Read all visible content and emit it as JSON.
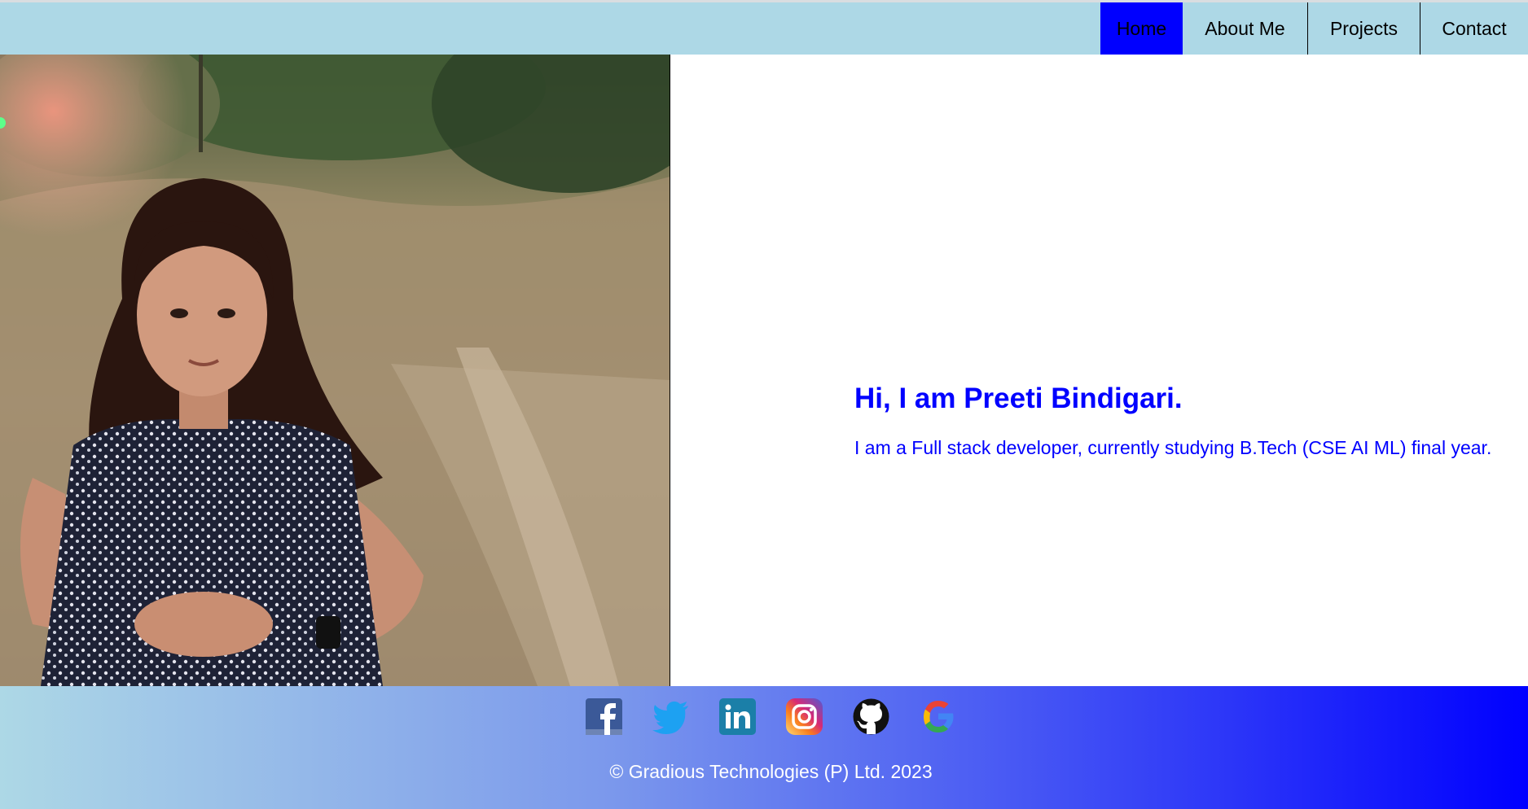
{
  "nav": {
    "items": [
      {
        "label": "Home",
        "active": true
      },
      {
        "label": "About Me"
      },
      {
        "label": "Projects"
      },
      {
        "label": "Contact"
      }
    ],
    "active_color": "#0000ff",
    "bar_color": "#add8e6"
  },
  "intro": {
    "heading": "Hi, I am Preeti Bindigari.",
    "subtext": "I am a Full stack developer, currently studying B.Tech (CSE AI ML) final year."
  },
  "footer": {
    "socials": [
      "facebook-icon",
      "twitter-icon",
      "linkedin-icon",
      "instagram-icon",
      "github-icon",
      "google-icon"
    ],
    "copyright": "© Gradious Technologies (P) Ltd. 2023"
  },
  "colors": {
    "accent": "#0000ff",
    "footer_gradient_start": "#add8e6",
    "footer_gradient_end": "#0000ff"
  }
}
